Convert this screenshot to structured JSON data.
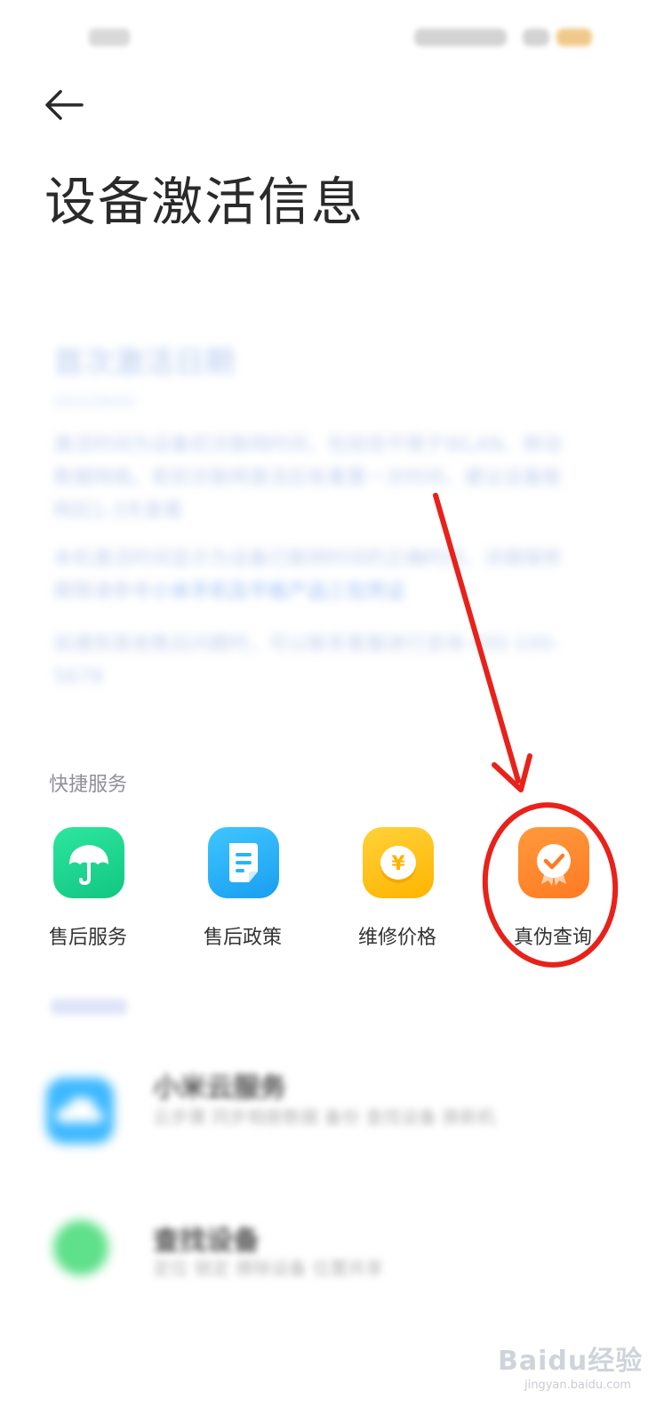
{
  "header": {
    "title": "设备激活信息"
  },
  "info": {
    "heading": "首次激活日期",
    "date": "2021/06/03",
    "para1": "激活时间为设备初次联网时间，包括但不限于WLAN、移动数据网络。若初次联网激活后有重置一次时间，建议设备联网后1-3天查看",
    "para2_prefix": "本机激活时间显示为设备已联网时间的正确时间，详细保修期限请参考",
    "para2_link": "小米手机及平板产品三包凭证",
    "para3": "如遇到其他售后问题时，可以联系客服进行咨询 400-100-5678"
  },
  "quick_services": {
    "label": "快捷服务",
    "items": [
      {
        "label": "售后服务",
        "icon": "umbrella-icon",
        "color": "#1fd68f"
      },
      {
        "label": "售后政策",
        "icon": "document-icon",
        "color": "#2ab4f5"
      },
      {
        "label": "维修价格",
        "icon": "yen-coin-icon",
        "color": "#ffc21a"
      },
      {
        "label": "真伪查询",
        "icon": "badge-check-icon",
        "color": "#ff8a2e"
      }
    ]
  },
  "list": [
    {
      "title": "小米云服务",
      "desc": "云步骤 同步相册数据 备份 查找设备 换新机",
      "icon": "cloud-icon",
      "color": "#3cb8ff"
    },
    {
      "title": "查找设备",
      "desc": "定位 锁定 擦除设备 位置共享",
      "icon": "find-device-icon",
      "color": "#5fe08a"
    }
  ],
  "watermark": {
    "text": "Baidu经验",
    "url": "jingyan.baidu.com"
  },
  "annotation_color": "#e8211a"
}
